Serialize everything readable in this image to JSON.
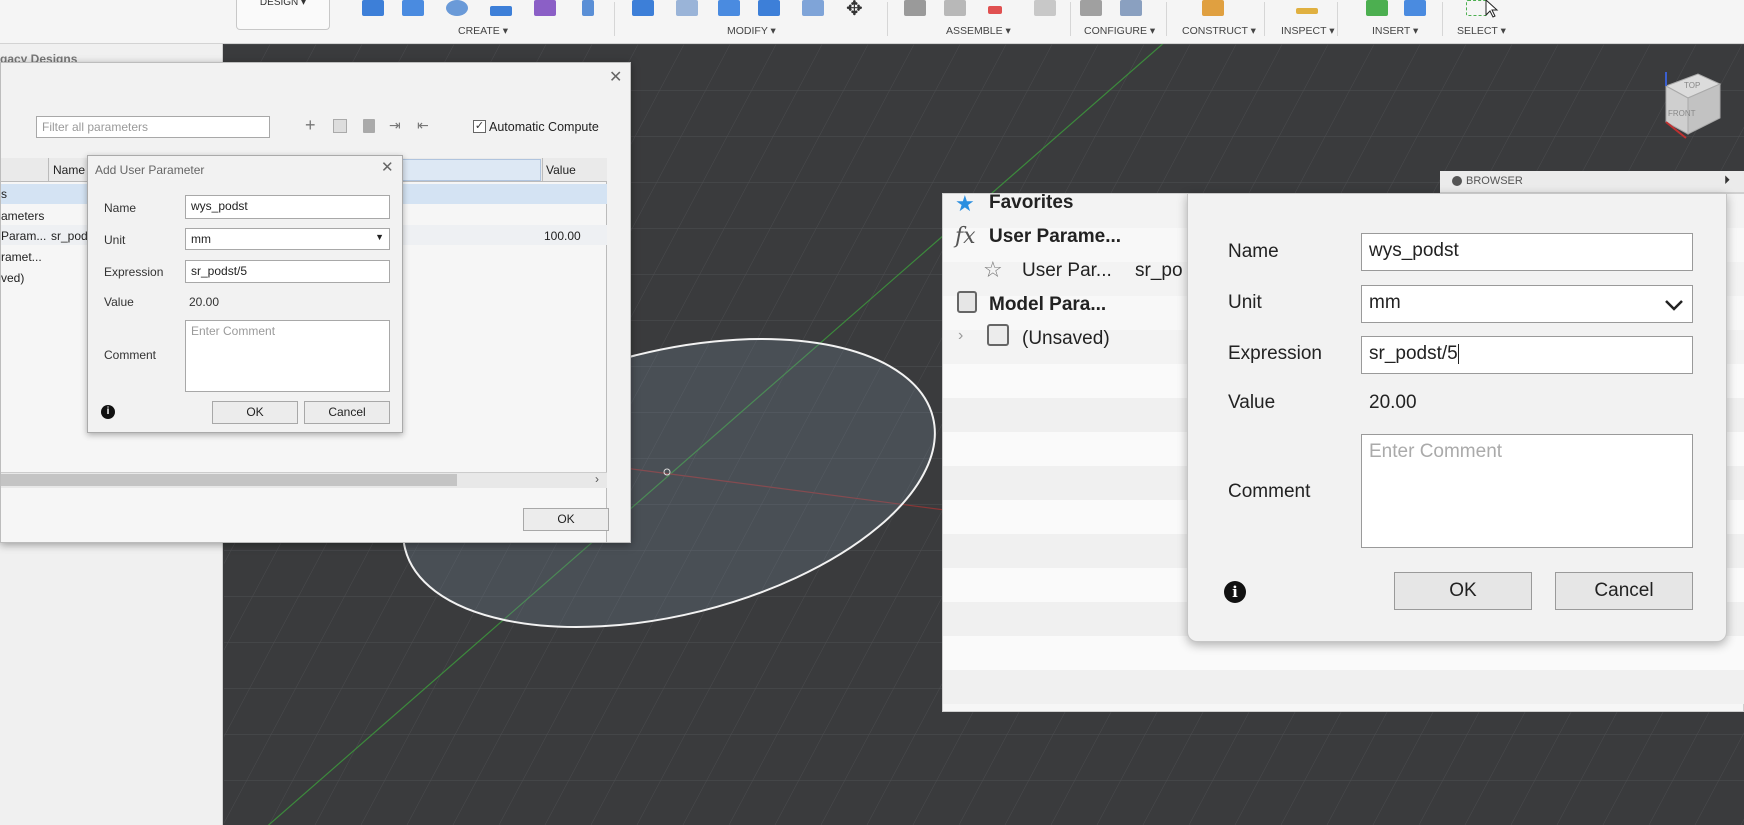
{
  "toolbar": {
    "workspace": "DESIGN",
    "groups": [
      "CREATE ▾",
      "MODIFY ▾",
      "ASSEMBLE ▾",
      "CONFIGURE ▾",
      "CONSTRUCT ▾",
      "INSPECT ▾",
      "INSERT ▾",
      "SELECT ▾"
    ]
  },
  "left_panel": {
    "partial_text": "gacy Designs"
  },
  "params_dialog": {
    "filter_placeholder": "Filter all parameters",
    "automatic_compute_label": "Automatic Compute",
    "automatic_compute_checked": true,
    "columns": [
      "Name",
      "Value"
    ],
    "rows": [
      {
        "text": "s",
        "name": "",
        "value": ""
      },
      {
        "text": "ameters",
        "name": "",
        "value": ""
      },
      {
        "text": "Param...",
        "name": "sr_pods",
        "value": "100.00"
      },
      {
        "text": "ramet...",
        "name": "",
        "value": ""
      },
      {
        "text": "ved)",
        "name": "",
        "value": ""
      }
    ],
    "ok_label": "OK",
    "close_icon": "close-icon"
  },
  "add_param_small": {
    "title": "Add User Parameter",
    "name_label": "Name",
    "name_value": "wys_podst",
    "unit_label": "Unit",
    "unit_value": "mm",
    "expression_label": "Expression",
    "expression_value": "sr_podst/5",
    "value_label": "Value",
    "value_value": "20.00",
    "comment_label": "Comment",
    "comment_placeholder": "Enter Comment",
    "ok_label": "OK",
    "cancel_label": "Cancel"
  },
  "browser": {
    "tab_title": "BROWSER",
    "items": [
      {
        "label": "Favorites",
        "icon": "star-filled-icon"
      },
      {
        "label": "User Parame...",
        "icon": "fx-icon"
      },
      {
        "label": "User Par...",
        "sub": "sr_po",
        "icon": "star-outline-icon"
      },
      {
        "label": "Model Para...",
        "icon": "body-icon"
      },
      {
        "label": "(Unsaved)",
        "icon": "component-icon"
      }
    ]
  },
  "add_param_big": {
    "name_label": "Name",
    "name_value": "wys_podst",
    "unit_label": "Unit",
    "unit_value": "mm",
    "expression_label": "Expression",
    "expression_value": "sr_podst/5",
    "value_label": "Value",
    "value_value": "20.00",
    "comment_label": "Comment",
    "comment_placeholder": "Enter Comment",
    "ok_label": "OK",
    "cancel_label": "Cancel"
  },
  "viewcube": {
    "top": "TOP",
    "front": "FRONT"
  }
}
